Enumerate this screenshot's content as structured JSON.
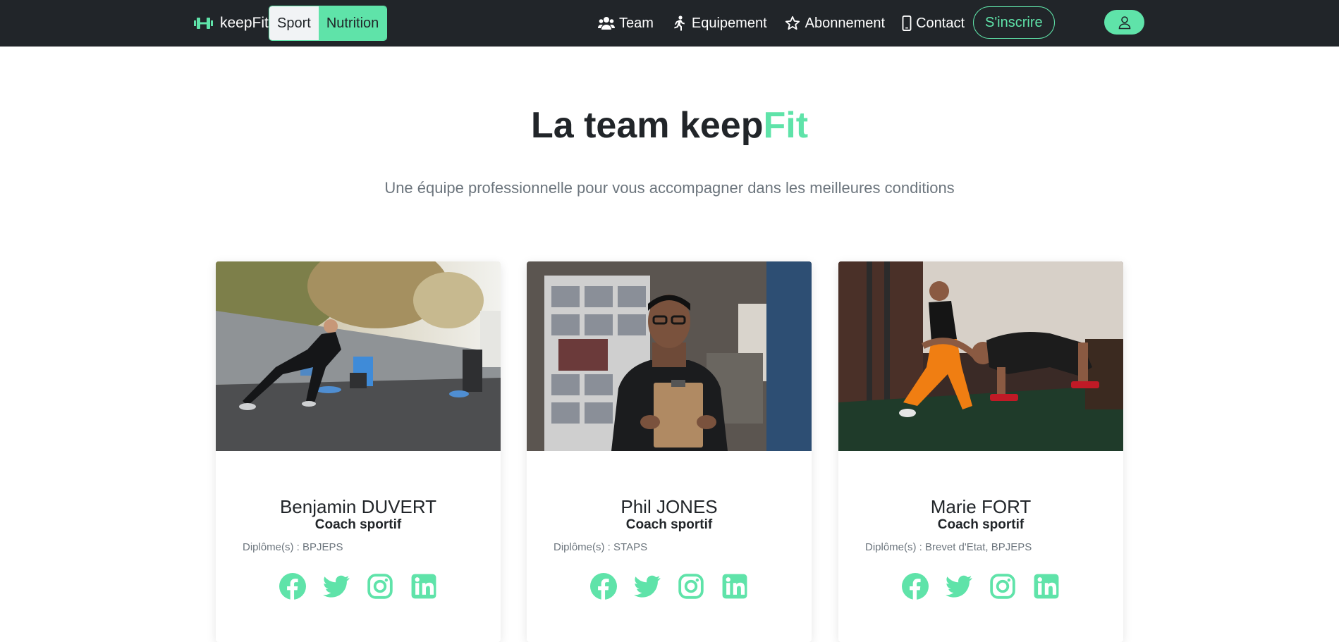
{
  "navbar": {
    "brand": "keepFit",
    "mode_sport": "Sport",
    "mode_nutrition": "Nutrition",
    "links": {
      "team": "Team",
      "equipement": "Equipement",
      "abonnement": "Abonnement",
      "contact": "Contact"
    },
    "signup": "S'inscrire"
  },
  "hero": {
    "title_main": "La team keep",
    "title_accent": "Fit",
    "subtitle": "Une équipe professionnelle pour vous accompagner dans les meilleures conditions"
  },
  "team": [
    {
      "name": "Benjamin DUVERT",
      "role": "Coach sportif",
      "diplomas": "Diplôme(s) : BPJEPS"
    },
    {
      "name": "Phil JONES",
      "role": "Coach sportif",
      "diplomas": "Diplôme(s) : STAPS"
    },
    {
      "name": "Marie FORT",
      "role": "Coach sportif",
      "diplomas": "Diplôme(s) : Brevet d'Etat, BPJEPS"
    }
  ],
  "colors": {
    "accent": "#5fe3a9",
    "navbar_bg": "#212529",
    "muted_text": "#6c757d"
  },
  "icons": {
    "brand": "dumbbell-icon",
    "team": "people-icon",
    "equipement": "running-person-icon",
    "abonnement": "star-icon",
    "contact": "phone-icon",
    "user": "person-icon",
    "social": [
      "facebook-icon",
      "twitter-icon",
      "instagram-icon",
      "linkedin-icon"
    ]
  }
}
